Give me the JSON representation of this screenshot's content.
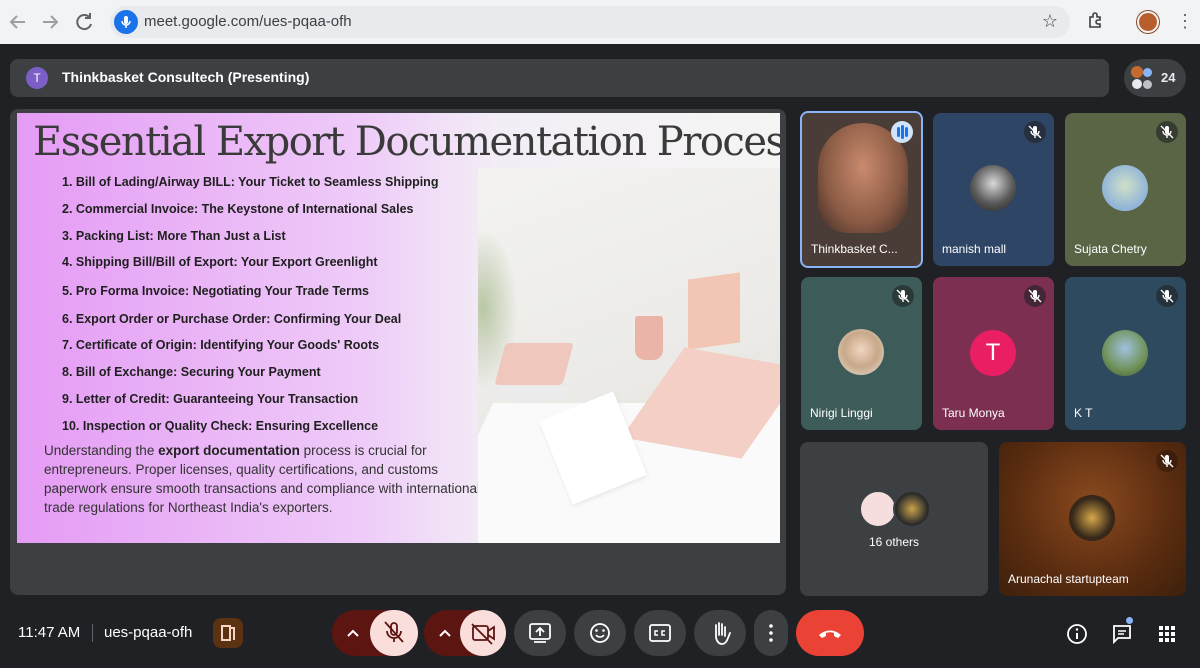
{
  "browser": {
    "url": "meet.google.com/ues-pqaa-ofh"
  },
  "meet": {
    "presenter_initial": "T",
    "presenting_title": "Thinkbasket Consultech (Presenting)",
    "participant_count": "24"
  },
  "slide": {
    "title": "Essential Export Documentation Process",
    "items": [
      "1. Bill of Lading/Airway BILL: Your Ticket to Seamless Shipping",
      "2. Commercial Invoice: The Keystone of International Sales",
      "3. Packing List: More Than Just a List",
      "4. Shipping Bill/Bill of Export: Your Export Greenlight",
      "5. Pro Forma Invoice: Negotiating Your Trade Terms",
      "6. Export Order or Purchase Order: Confirming Your Deal",
      "7. Certificate of Origin: Identifying Your Goods' Roots",
      "8. Bill of Exchange: Securing Your Payment",
      "9. Letter of Credit: Guaranteeing Your Transaction",
      "10. Inspection or Quality Check: Ensuring Excellence"
    ],
    "paragraph_before": "Understanding the ",
    "paragraph_bold": "export documentation",
    "paragraph_after": " process is crucial for entrepreneurs. Proper licenses, quality certifications, and customs paperwork ensure smooth transactions and compliance with international trade regulations for Northeast India's exporters."
  },
  "participants": [
    {
      "name": "Thinkbasket C...",
      "state": "speaking"
    },
    {
      "name": "manish mall",
      "state": "muted"
    },
    {
      "name": "Sujata Chetry",
      "state": "muted"
    },
    {
      "name": "Nirigi Linggi",
      "state": "muted"
    },
    {
      "name": "Taru Monya",
      "state": "muted",
      "initial": "T"
    },
    {
      "name": "K T",
      "state": "muted"
    },
    {
      "name": "16 others"
    },
    {
      "name": "Arunachal startupteam",
      "state": "muted"
    }
  ],
  "bottom": {
    "time": "11:47 AM",
    "meeting_code": "ues-pqaa-ofh"
  },
  "colors": {
    "end_call": "#ea4335",
    "muted_control": "#f9dedc",
    "speaking_outline": "#8ab4f8"
  }
}
